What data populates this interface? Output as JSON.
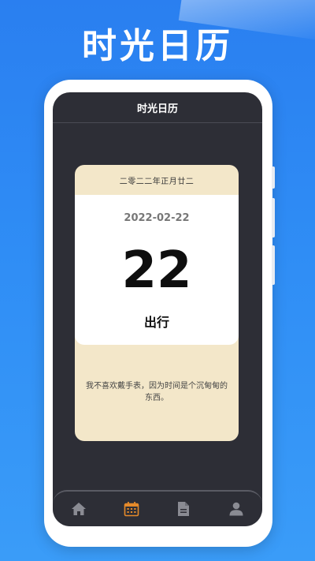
{
  "promo": {
    "title": "时光日历"
  },
  "app": {
    "header_title": "时光日历"
  },
  "calendar": {
    "lunar_date": "二零二二年正月廿二",
    "date": "2022-02-22",
    "day": "22",
    "advice": "出行",
    "quote": "我不喜欢戴手表，因为时间是个沉甸甸的东西。"
  },
  "tabs": [
    {
      "icon": "home-icon",
      "active": false
    },
    {
      "icon": "calendar-icon",
      "active": true
    },
    {
      "icon": "document-icon",
      "active": false
    },
    {
      "icon": "user-icon",
      "active": false
    }
  ],
  "colors": {
    "background": "#2f8df5",
    "screen": "#2d2e36",
    "card": "#f3e7c9",
    "active_tab": "#e58a2a",
    "inactive_tab": "#8a8b93"
  }
}
